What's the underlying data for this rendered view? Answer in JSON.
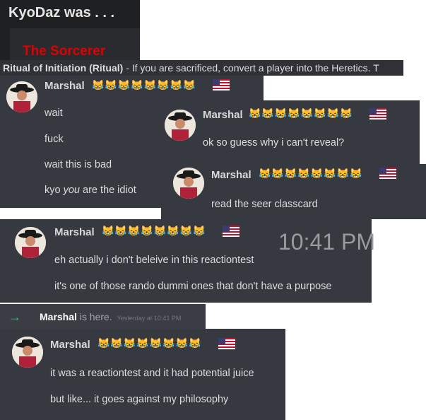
{
  "header": {
    "title": "KyoDaz was . . .",
    "role": "The Sorcerer",
    "role_color": "#e00000"
  },
  "ability": {
    "name": "Ritual of Initiation (Ritual)",
    "desc": " - If you are sacrificed, convert a player into the Heretics. T"
  },
  "user": {
    "name": "Marshal",
    "emoji_row": "😹😹😹😹😹😹😹😹",
    "flag_icon": "us-flag-icon"
  },
  "cards": [
    {
      "messages": [
        "wait",
        "fuck",
        "wait this is bad"
      ],
      "italic_line": {
        "pre": "kyo ",
        "em": "you",
        "post": " are the idiot"
      }
    },
    {
      "messages": [
        "ok so guess why i can't reveal?"
      ]
    },
    {
      "messages": [
        "read the seer classcard"
      ]
    },
    {
      "timestamp": "10:41 PM",
      "messages": [
        "eh actually i don't beleive in this reactiontest",
        "it's one of those rando dummi ones that don't have a purpose"
      ]
    },
    {
      "messages": [
        "it was a reactiontest and it had potential juice",
        "but like... it goes against my philosophy"
      ]
    }
  ],
  "join": {
    "arrow": "→",
    "user": "Marshal",
    "text": " is here.",
    "time": "Yesterday at 10:41 PM"
  }
}
